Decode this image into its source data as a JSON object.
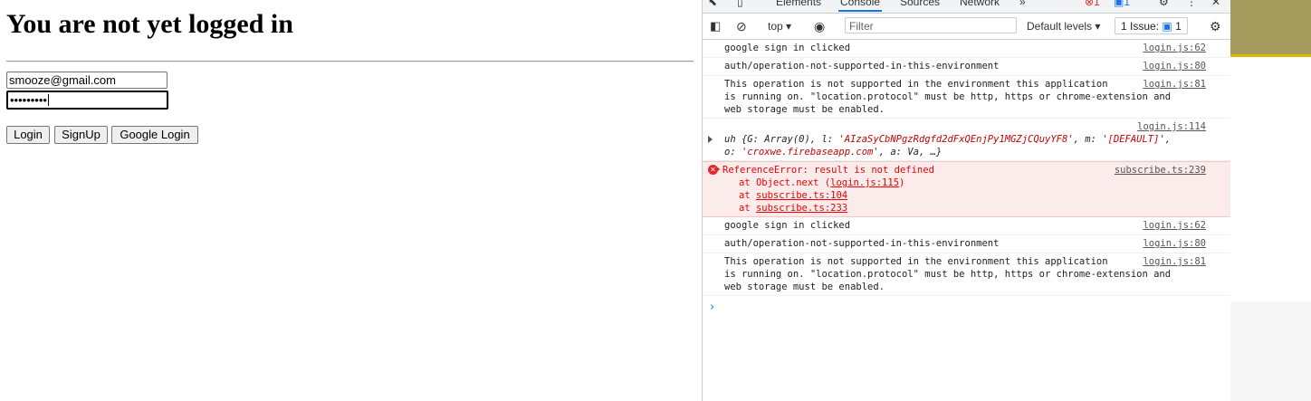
{
  "page": {
    "heading": "You are not yet logged in",
    "email_value": "smooze@gmail.com",
    "password_value": "•••••••••",
    "buttons": {
      "login": "Login",
      "signup": "SignUp",
      "google": "Google Login"
    }
  },
  "devtools": {
    "tabs": [
      "Elements",
      "Console",
      "Sources",
      "Network",
      "»"
    ],
    "active_tab": "Console",
    "badges": {
      "errors": "1",
      "messages": "1"
    },
    "toolbar": {
      "context": "top",
      "filter_placeholder": "Filter",
      "levels": "Default levels",
      "issues": "1 Issue:",
      "issues_count": "1"
    },
    "messages": [
      {
        "text": "google sign in clicked",
        "source": "login.js:62"
      },
      {
        "text": "auth/operation-not-supported-in-this-environment",
        "source": "login.js:80"
      },
      {
        "text": "This operation is not supported in the environment this application\nis running on. \"location.protocol\" must be http, https or chrome-extension and\nweb storage must be enabled.",
        "source": "login.js:81"
      },
      {
        "source": "login.js:114",
        "obj_prefix": "uh {G: Array(0), l: ",
        "obj_l": "'AIzaSyCbNPgzRdgfd2dFxQEnjPy1MGZjCQuyYF8'",
        "obj_mid": ", m: ",
        "obj_m": "'[DEFAULT]'",
        "obj_comma": ",",
        "obj_o_prefix": "o: ",
        "obj_o": "'croxwe.firebaseapp.com'",
        "obj_suffix": ", a: Va, …}"
      },
      {
        "error": true,
        "text": "ReferenceError: result is not defined",
        "source": "subscribe.ts:239",
        "stack": [
          "at Object.next (",
          "login.js:115",
          ")",
          "at ",
          "subscribe.ts:104",
          "at ",
          "subscribe.ts:233"
        ]
      },
      {
        "text": "google sign in clicked",
        "source": "login.js:62"
      },
      {
        "text": "auth/operation-not-supported-in-this-environment",
        "source": "login.js:80"
      },
      {
        "text": "This operation is not supported in the environment this application\nis running on. \"location.protocol\" must be http, https or chrome-extension and\nweb storage must be enabled.",
        "source": "login.js:81"
      }
    ],
    "prompt": "›"
  },
  "colors": {
    "accent": "#1a73e8",
    "error": "#e02929",
    "error_bg": "#fcebeb",
    "olive": "#a49a5b",
    "gold": "#e0b700"
  }
}
